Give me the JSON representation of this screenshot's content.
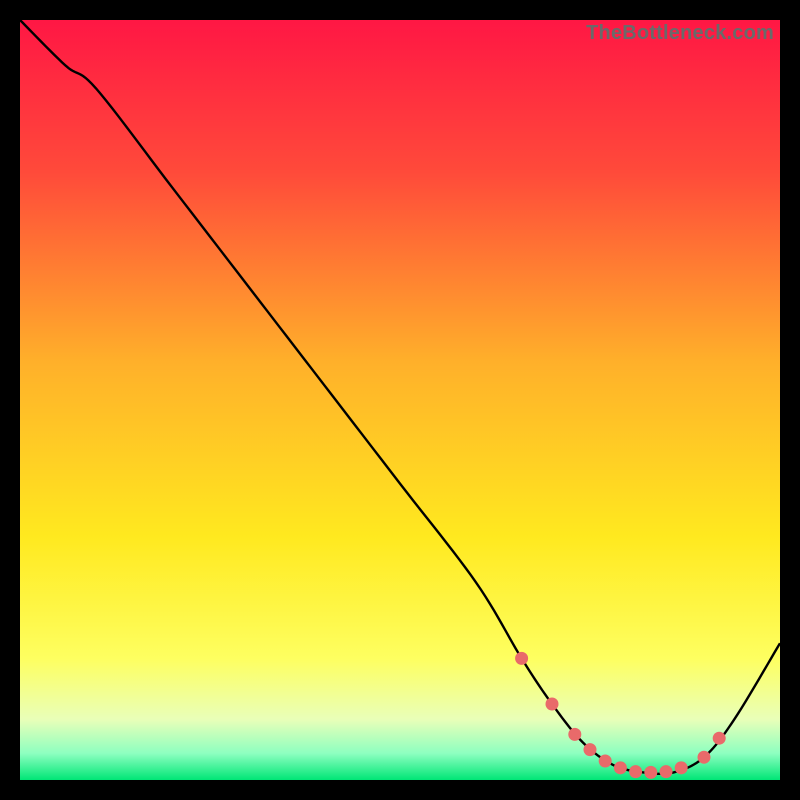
{
  "watermark": "TheBottleneck.com",
  "colors": {
    "frame": "#000000",
    "curve": "#000000",
    "markers": "#e96a6a",
    "grad_top": "#ff1744",
    "grad_upper": "#ff5337",
    "grad_mid": "#ffd21f",
    "grad_lower": "#ffff3a",
    "grad_pale": "#f6ffb0",
    "grad_green": "#00e676"
  },
  "chart_data": {
    "type": "line",
    "title": "",
    "xlabel": "",
    "ylabel": "",
    "xlim": [
      0,
      100
    ],
    "ylim": [
      0,
      100
    ],
    "series": [
      {
        "name": "bottleneck-curve",
        "x": [
          0,
          6,
          10,
          20,
          30,
          40,
          50,
          60,
          66,
          70,
          74,
          78,
          82,
          86,
          90,
          94,
          100
        ],
        "y": [
          100,
          94,
          91,
          78,
          65,
          52,
          39,
          26,
          16,
          10,
          5,
          2,
          1,
          1,
          3,
          8,
          18
        ]
      }
    ],
    "markers": {
      "name": "highlight-band",
      "x": [
        66,
        70,
        73,
        75,
        77,
        79,
        81,
        83,
        85,
        87,
        90,
        92
      ],
      "y": [
        16,
        10,
        6,
        4,
        2.5,
        1.6,
        1.1,
        1,
        1.1,
        1.6,
        3,
        5.5
      ]
    },
    "gradient_stops": [
      {
        "offset": 0.0,
        "color": "#ff1744"
      },
      {
        "offset": 0.2,
        "color": "#ff4a3a"
      },
      {
        "offset": 0.45,
        "color": "#ffb02a"
      },
      {
        "offset": 0.68,
        "color": "#ffe91f"
      },
      {
        "offset": 0.84,
        "color": "#feff60"
      },
      {
        "offset": 0.92,
        "color": "#e9ffb8"
      },
      {
        "offset": 0.965,
        "color": "#8dffc0"
      },
      {
        "offset": 1.0,
        "color": "#00e676"
      }
    ]
  }
}
